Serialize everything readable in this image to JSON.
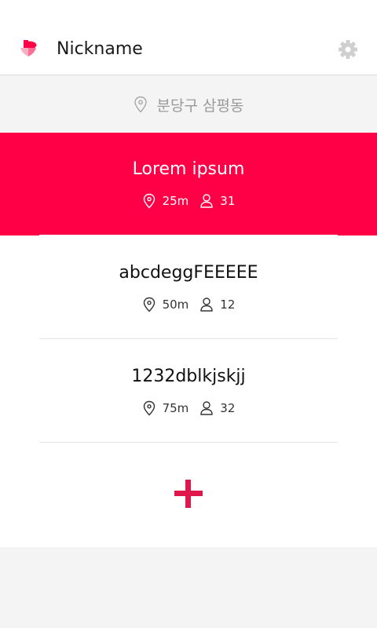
{
  "header": {
    "nickname": "Nickname",
    "brand_color": "#ff0047",
    "logo_icon": "heart-logo-icon",
    "settings_icon": "gear-icon"
  },
  "location": {
    "icon": "location-pin-icon",
    "text": "분당구 삼평동"
  },
  "rooms": [
    {
      "title": "Lorem ipsum",
      "distance": "25m",
      "members": "31",
      "selected": true
    },
    {
      "title": "abcdeggFEEEEE",
      "distance": "50m",
      "members": "12",
      "selected": false
    },
    {
      "title": "1232dblkjskjj",
      "distance": "75m",
      "members": "32",
      "selected": false
    }
  ],
  "add_button": {
    "icon": "plus-icon",
    "color": "#e0174a"
  }
}
